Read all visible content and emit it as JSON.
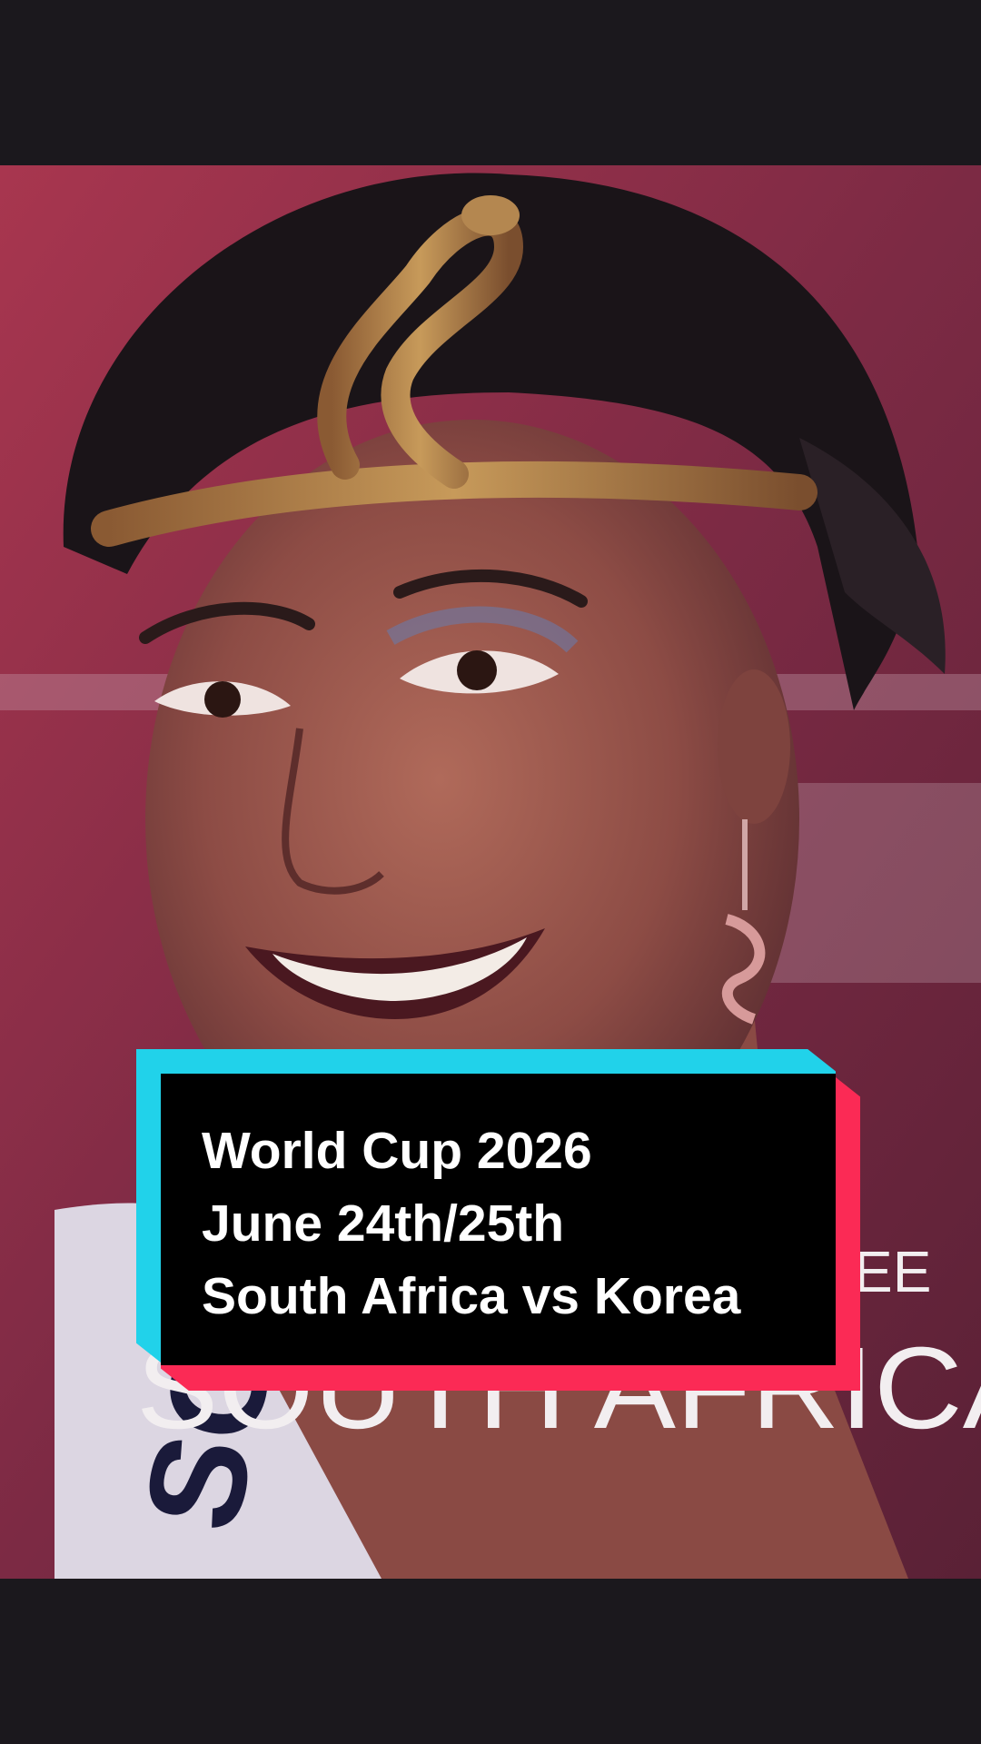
{
  "caption": {
    "lines": [
      "World Cup 2026",
      "June 24th/25th",
      "South Africa vs Korea"
    ]
  },
  "background_overlay_text": {
    "small": "EE",
    "large": "SOUTH AFRICA",
    "sash": "SOU"
  },
  "colors": {
    "letterbox": "#1b181d",
    "caption_bg": "#000000",
    "caption_cyan": "#21d2ea",
    "caption_red": "#fb2a55",
    "caption_text": "#ffffff",
    "backdrop": "#8a2c45"
  },
  "icons": [
    "serpent-headband",
    "spiral-earring"
  ]
}
